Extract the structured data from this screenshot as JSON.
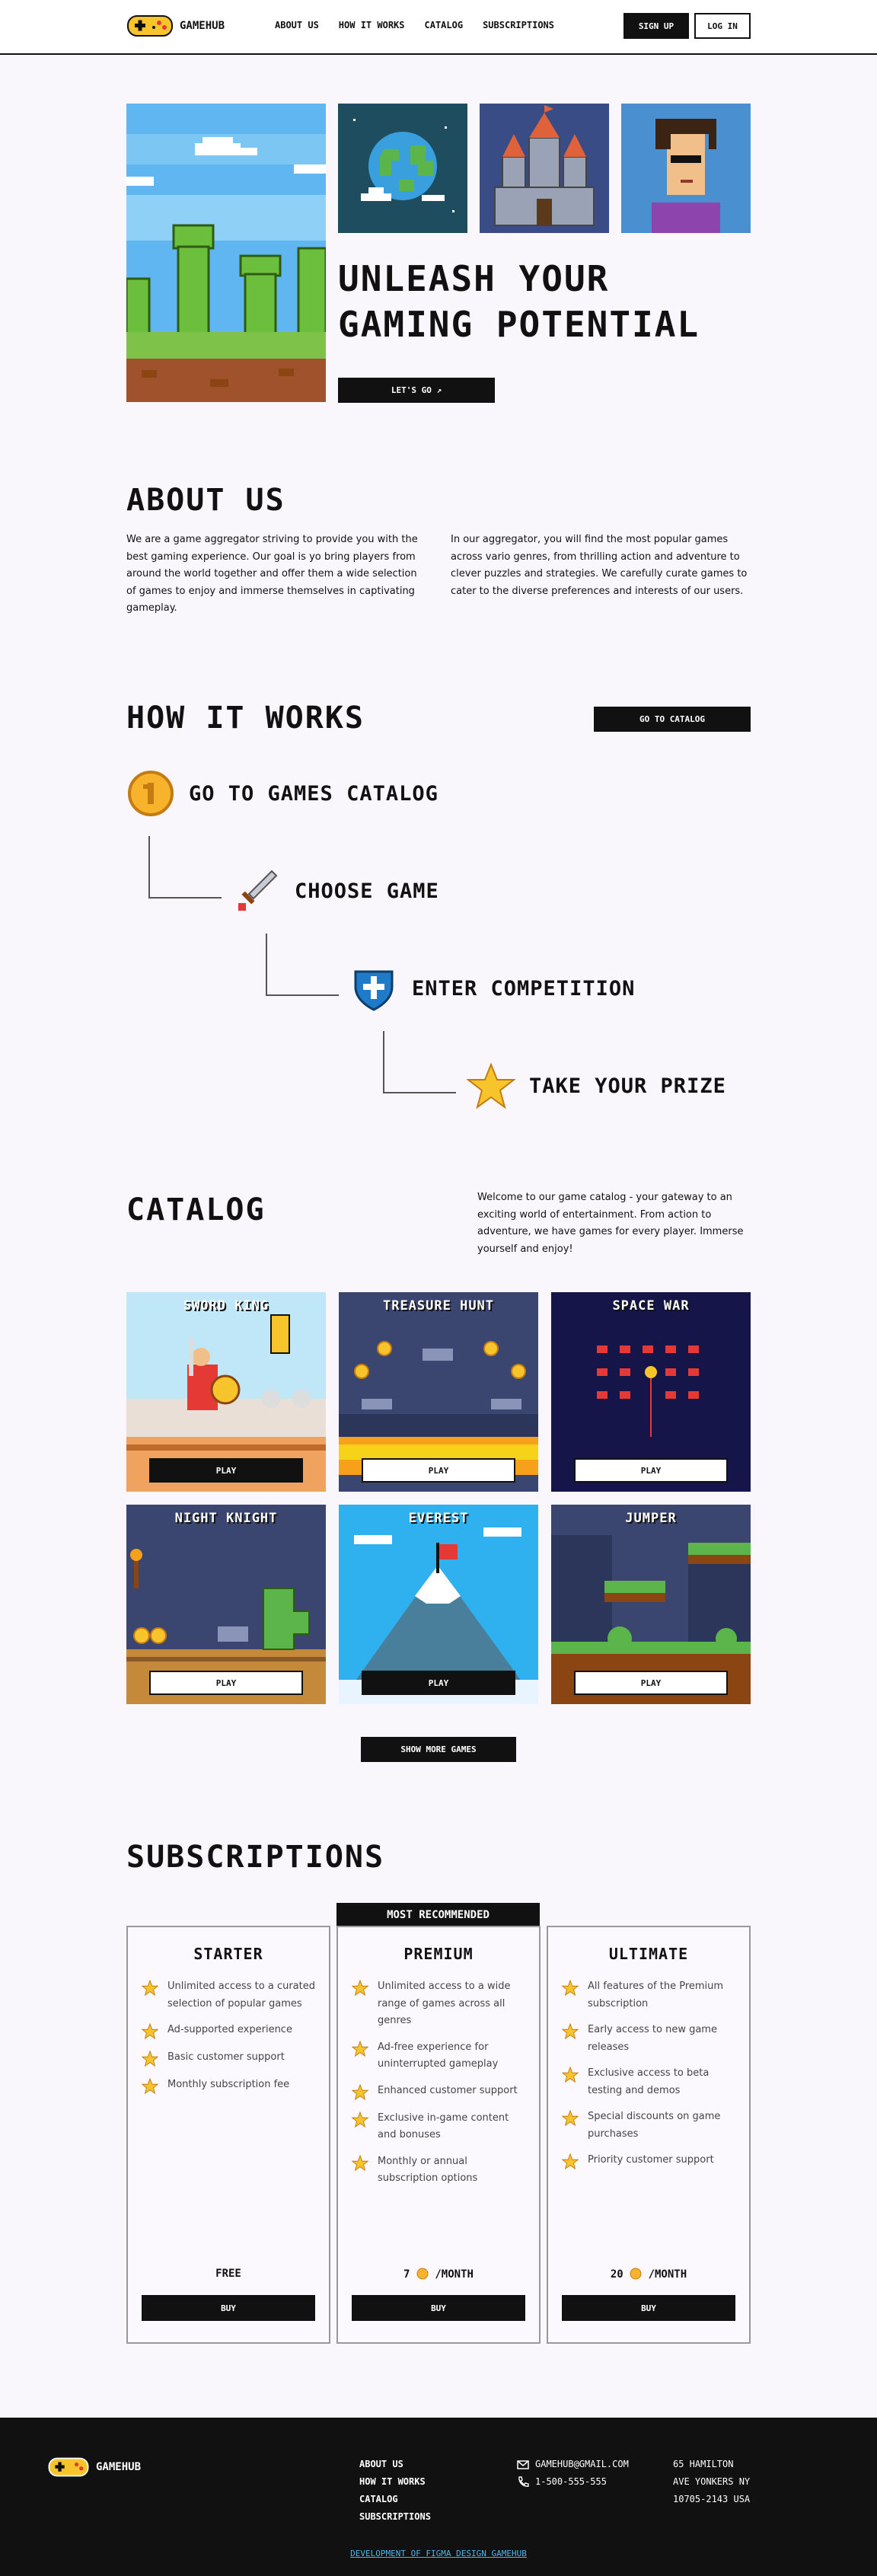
{
  "header": {
    "logo_text": "GAMEHUB",
    "nav": [
      "ABOUT US",
      "HOW IT WORKS",
      "CATALOG",
      "SUBSCRIPTIONS"
    ],
    "signup_label": "SIGN UP",
    "login_label": "LOG IN"
  },
  "hero": {
    "title_line1": "UNLEASH YOUR",
    "title_line2": "GAMING POTENTIAL",
    "cta_label": "LET'S GO ↗"
  },
  "about": {
    "title": "ABOUT US",
    "col1": "We are a game aggregator striving to provide you with the best gaming experience. Our goal is yo bring players from around the world together and offer them a wide selection of games to enjoy and immerse themselves in captivating gameplay.",
    "col2": "In our aggregator, you will find the most popular games across vario genres, from thrilling action and adventure to clever puzzles and strategies. We carefully curate games to cater to the diverse preferences and interests of our users."
  },
  "how": {
    "title": "HOW IT WORKS",
    "cta_label": "GO TO CATALOG",
    "steps": [
      {
        "label": "GO TO GAMES CATALOG",
        "icon": "coin-icon"
      },
      {
        "label": "CHOOSE GAME",
        "icon": "sword-icon"
      },
      {
        "label": "ENTER COMPETITION",
        "icon": "shield-icon"
      },
      {
        "label": "TAKE YOUR PRIZE",
        "icon": "star-icon"
      }
    ]
  },
  "catalog": {
    "title": "CATALOG",
    "intro": "Welcome to our game catalog - your gateway to an exciting world of entertainment. From action to adventure, we have games for every player. Immerse yourself and enjoy!",
    "play_label": "PLAY",
    "games": [
      "SWORD KING",
      "TREASURE HUNT",
      "SPACE WAR",
      "NIGHT KNIGHT",
      "EVEREST",
      "JUMPER"
    ],
    "more_label": "SHOW MORE GAMES"
  },
  "subscriptions": {
    "title": "SUBSCRIPTIONS",
    "recommended_label": "MOST RECOMMENDED",
    "buy_label": "BUY",
    "plans": [
      {
        "name": "STARTER",
        "features": [
          "Unlimited access to a curated selection of popular games",
          "Ad-supported experience",
          "Basic customer support",
          "Monthly subscription fee"
        ],
        "price": "FREE"
      },
      {
        "name": "PREMIUM",
        "features": [
          "Unlimited access to a wide range of games across all genres",
          "Ad-free experience for uninterrupted gameplay",
          "Enhanced customer support",
          "Exclusive in-game content and bonuses",
          "Monthly or annual subscription options"
        ],
        "price_value": "7",
        "price_unit": "/MONTH"
      },
      {
        "name": "ULTIMATE",
        "features": [
          "All features of the Premium subscription",
          "Early access to new game releases",
          "Exclusive access to beta testing and demos",
          "Special discounts on game purchases",
          "Priority customer support"
        ],
        "price_value": "20",
        "price_unit": "/MONTH"
      }
    ]
  },
  "footer": {
    "logo_text": "GAMEHUB",
    "nav": [
      "ABOUT US",
      "HOW IT WORKS",
      "CATALOG",
      "SUBSCRIPTIONS"
    ],
    "email": "GAMEHUB@GMAIL.COM",
    "phone": "1-500-555-555",
    "address": [
      "65 HAMILTON",
      "AVE YONKERS NY",
      "10705-2143 USA"
    ],
    "credit": "DEVELOPMENT OF FIGMA DESIGN GAMEHUB"
  },
  "colors": {
    "accent_yellow": "#f7c52b",
    "dark": "#111111",
    "link_blue": "#4db6e8"
  }
}
